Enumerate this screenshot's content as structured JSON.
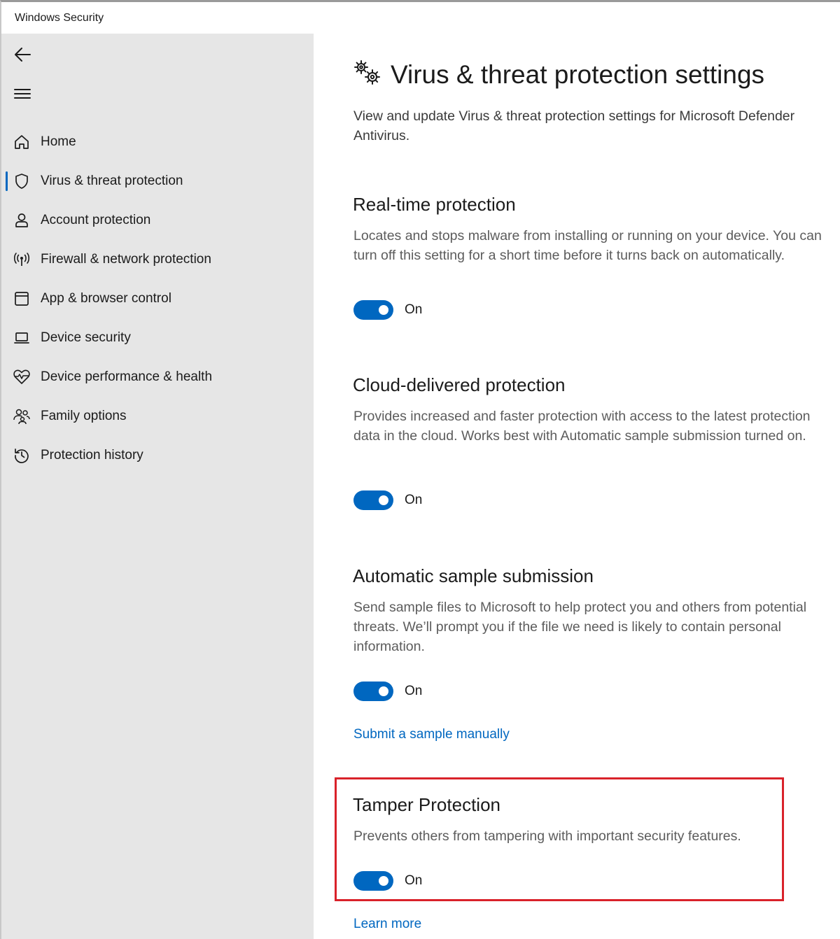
{
  "window": {
    "title": "Windows Security"
  },
  "sidebar": {
    "back_icon": "back-arrow-icon",
    "menu_icon": "hamburger-menu-icon",
    "items": [
      {
        "label": "Home",
        "icon": "home-icon",
        "selected": false
      },
      {
        "label": "Virus & threat protection",
        "icon": "shield-icon",
        "selected": true
      },
      {
        "label": "Account protection",
        "icon": "person-icon",
        "selected": false
      },
      {
        "label": "Firewall & network protection",
        "icon": "wireless-antenna-icon",
        "selected": false
      },
      {
        "label": "App & browser control",
        "icon": "app-window-icon",
        "selected": false
      },
      {
        "label": "Device security",
        "icon": "laptop-icon",
        "selected": false
      },
      {
        "label": "Device performance & health",
        "icon": "heart-pulse-icon",
        "selected": false
      },
      {
        "label": "Family options",
        "icon": "family-icon",
        "selected": false
      },
      {
        "label": "Protection history",
        "icon": "history-icon",
        "selected": false
      }
    ]
  },
  "main": {
    "header_icon": "gears-icon",
    "title": "Virus & threat protection settings",
    "subtitle": "View and update Virus & threat protection settings for Microsoft Defender Antivirus.",
    "sections": [
      {
        "title": "Real-time protection",
        "description": "Locates and stops malware from installing or running on your device. You can turn off this setting for a short time before it turns back on automatically.",
        "toggle_state": "On"
      },
      {
        "title": "Cloud-delivered protection",
        "description": "Provides increased and faster protection with access to the latest protection data in the cloud. Works best with Automatic sample submission turned on.",
        "toggle_state": "On"
      },
      {
        "title": "Automatic sample submission",
        "description": "Send sample files to Microsoft to help protect you and others from potential threats. We’ll prompt you if the file we need is likely to contain personal information.",
        "toggle_state": "On",
        "link": "Submit a sample manually"
      },
      {
        "title": "Tamper Protection",
        "description": "Prevents others from tampering with important security features.",
        "toggle_state": "On",
        "link": "Learn more"
      }
    ]
  },
  "colors": {
    "accent": "#0067c0",
    "sidebar_bg": "#e6e6e6",
    "highlight_border": "#d9222a"
  }
}
